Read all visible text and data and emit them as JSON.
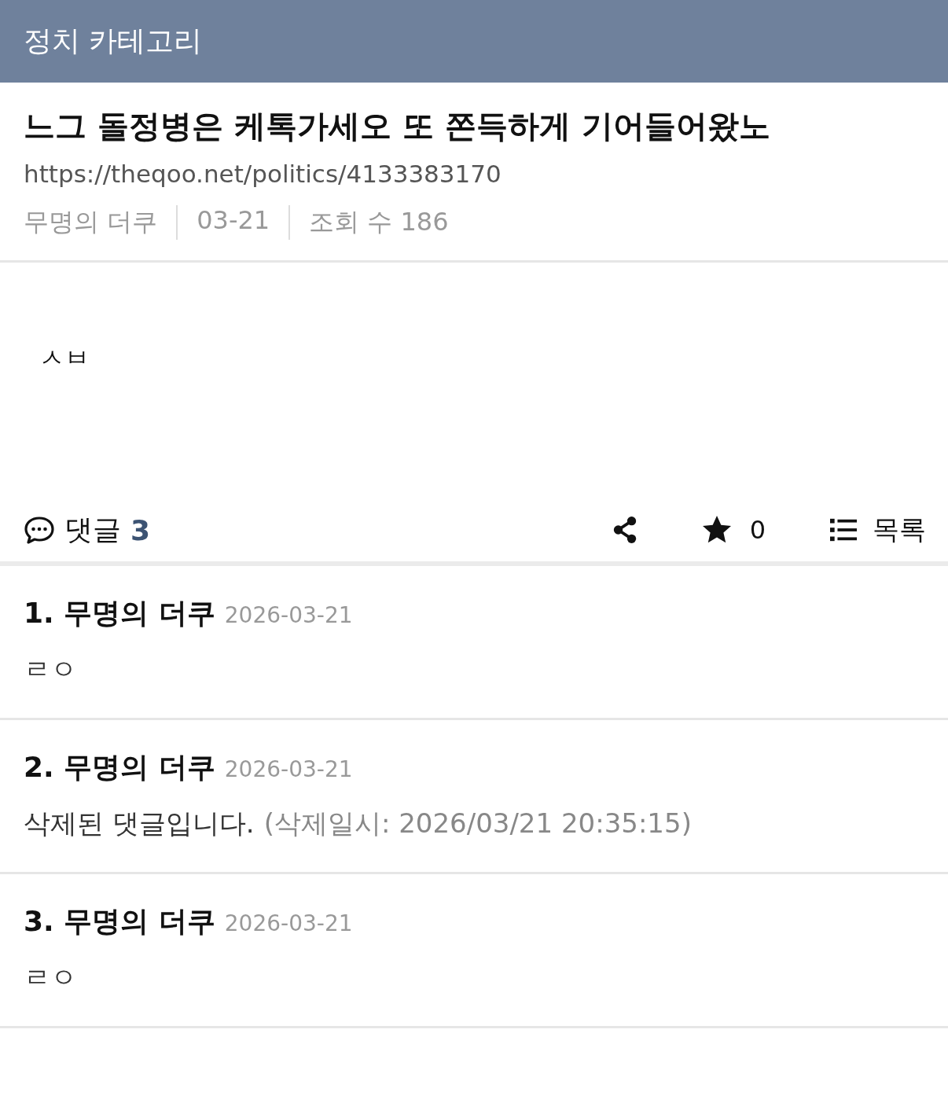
{
  "header": {
    "title": "정치 카테고리"
  },
  "post": {
    "title": "느그 돌정병은 케톡가세오 또 쫀득하게 기어들어왔노",
    "url": "https://theqoo.net/politics/4133383170",
    "meta": [
      "무명의 더쿠",
      "03-21",
      "조회 수 186"
    ],
    "body": "ㅅㅂ"
  },
  "actions": {
    "comments_label": "댓글",
    "comments_count": "3",
    "stars_count": "0",
    "list_label": "목록"
  },
  "comments": [
    {
      "number": "1.",
      "author": "무명의 더쿠",
      "date": "2026-03-21",
      "text": "ㄹㅇ"
    },
    {
      "number": "2.",
      "author": "무명의 더쿠",
      "date": "2026-03-21",
      "text": "삭제된 댓글입니다.",
      "note": "(삭제일시: 2026/03/21 20:35:15)"
    },
    {
      "number": "3.",
      "author": "무명의 더쿠",
      "date": "2026-03-21",
      "text": "ㄹㅇ"
    }
  ]
}
